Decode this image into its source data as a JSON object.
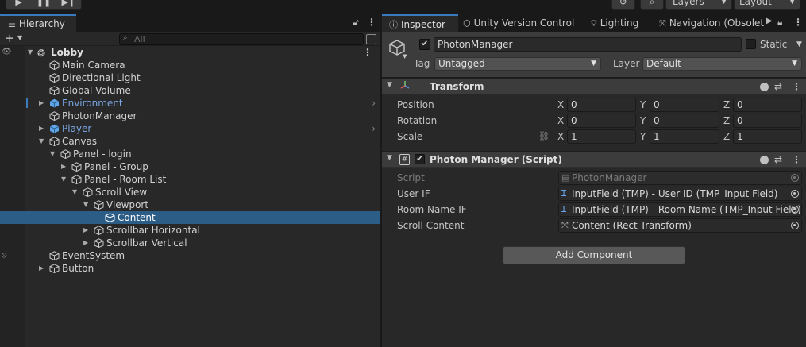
{
  "toolbar": {
    "play_icon": "play-icon",
    "pause_icon": "pause-icon",
    "step_icon": "step-icon",
    "history_icon": "history-icon",
    "search_icon": "search-icon",
    "layers_label": "Layers",
    "layout_label": "Layout"
  },
  "hierarchy": {
    "tab_label": "Hierarchy",
    "search_placeholder": "All",
    "rows": [
      {
        "label": "Lobby"
      },
      {
        "label": "Main Camera"
      },
      {
        "label": "Directional Light"
      },
      {
        "label": "Global Volume"
      },
      {
        "label": "Environment"
      },
      {
        "label": "PhotonManager"
      },
      {
        "label": "Player"
      },
      {
        "label": "Canvas"
      },
      {
        "label": "Panel - login"
      },
      {
        "label": "Panel - Group"
      },
      {
        "label": "Panel - Room List"
      },
      {
        "label": "Scroll View"
      },
      {
        "label": "Viewport"
      },
      {
        "label": "Content"
      },
      {
        "label": "Scrollbar Horizontal"
      },
      {
        "label": "Scrollbar Vertical"
      },
      {
        "label": "EventSystem"
      },
      {
        "label": "Button"
      }
    ]
  },
  "inspector": {
    "tabs": [
      {
        "label": "Inspector"
      },
      {
        "label": "Unity Version Control"
      },
      {
        "label": "Lighting"
      },
      {
        "label": "Navigation (Obsolete"
      }
    ],
    "object_name": "PhotonManager",
    "static_label": "Static",
    "tag_label": "Tag",
    "tag_value": "Untagged",
    "layer_label": "Layer",
    "layer_value": "Default",
    "transform": {
      "title": "Transform",
      "position_label": "Position",
      "rotation_label": "Rotation",
      "scale_label": "Scale",
      "axis_x": "X",
      "axis_y": "Y",
      "axis_z": "Z",
      "position": [
        "0",
        "0",
        "0"
      ],
      "rotation": [
        "0",
        "0",
        "0"
      ],
      "scale": [
        "1",
        "1",
        "1"
      ]
    },
    "script_component": {
      "title": "Photon Manager (Script)",
      "script_label": "Script",
      "script_value": "PhotonManager",
      "user_if_label": "User IF",
      "user_if_value": "InputField (TMP)  - User ID (TMP_Input Field)",
      "room_name_if_label": "Room Name IF",
      "room_name_if_value": "InputField (TMP)  - Room Name (TMP_Input Field)",
      "scroll_content_label": "Scroll Content",
      "scroll_content_value": "Content (Rect Transform)"
    },
    "add_component_label": "Add Component"
  },
  "colors": {
    "selection": "#2c5d87",
    "accent": "#3a79bb",
    "prefab_text": "#7ba7e4",
    "panel_bg": "#282828"
  }
}
